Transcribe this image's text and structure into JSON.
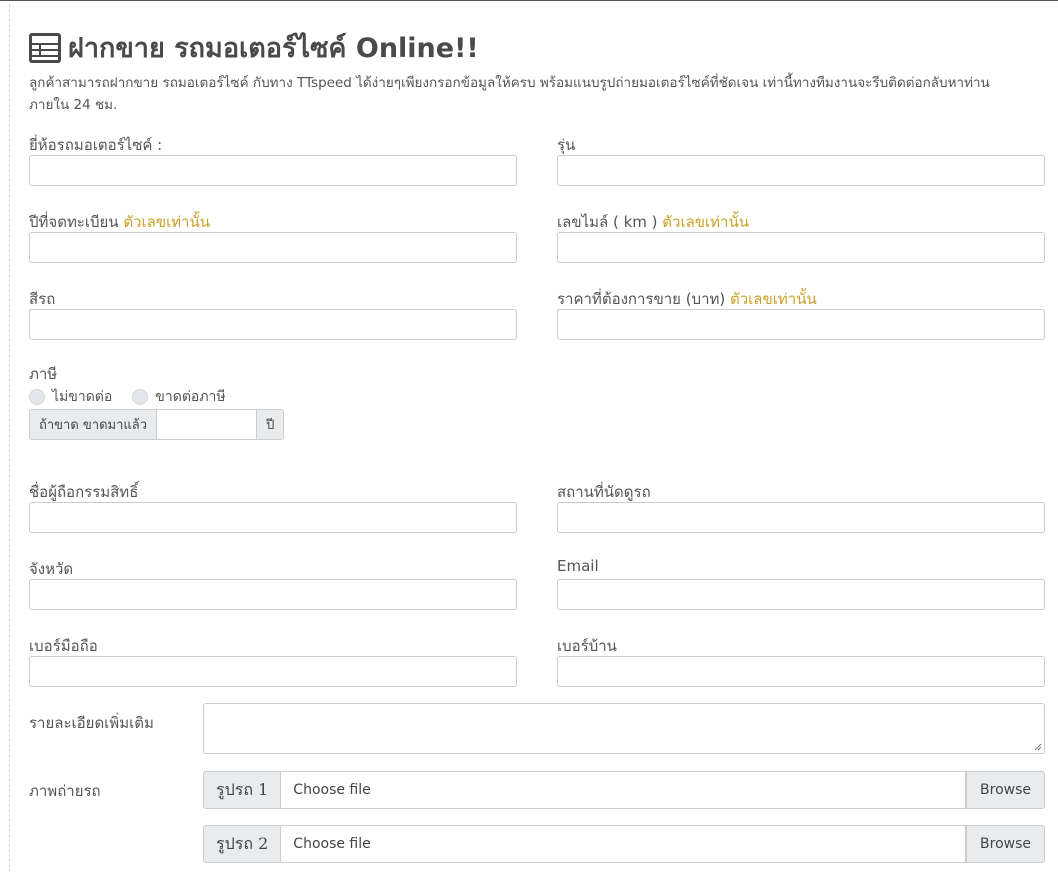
{
  "page": {
    "title": "ฝากขาย รถมอเตอร์ไซค์ Online!!",
    "intro_line1": "ลูกค้าสามารถฝากขาย รถมอเตอร์ไซค์ กับทาง TTspeed ได้ง่ายๆเพียงกรอกข้อมูลให้ครบ พร้อมแนบรูปถ่ายมอเตอร์ไซค์ที่ชัดเจน เท่านี้ทางทีมงานจะรีบติดต่อกลับหาท่าน",
    "intro_line2": "ภายใน 24 ชม."
  },
  "form": {
    "brand_label": "ยี่ห้อรถมอเตอร์ไซค์ :",
    "model_label": "รุ่น",
    "year_label": "ปีที่จดทะเบียน",
    "numbers_only": "ตัวเลขเท่านั้น",
    "mileage_label": "เลขไมล์ ( km )",
    "color_label": "สีรถ",
    "price_label": "ราคาที่ต้องการขาย (บาท)",
    "tax_label": "ภาษี",
    "tax_options": [
      "ไม่ขาดต่อ",
      "ขาดต่อภาษี"
    ],
    "tax_lapsed_prefix": "ถ้าขาด ขาดมาแล้ว",
    "tax_lapsed_suffix": "ปี",
    "owner_label": "ชื่อผู้ถือกรรมสิทธิ์",
    "location_label": "สถานที่นัดดูรถ",
    "province_label": "จังหวัด",
    "email_label": "Email",
    "mobile_label": "เบอร์มือถือ",
    "home_phone_label": "เบอร์บ้าน",
    "details_label": "รายละเอียดเพิ่มเติม",
    "photos_label": "ภาพถ่ายรถ",
    "photos": [
      {
        "prefix": "รูปรถ 1",
        "placeholder": "Choose file",
        "browse": "Browse"
      },
      {
        "prefix": "รูปรถ 2",
        "placeholder": "Choose file",
        "browse": "Browse"
      }
    ]
  },
  "colors": {
    "hint": "#c9a227",
    "title": "#4a4a4a"
  },
  "icons": {
    "title": "form-icon"
  }
}
